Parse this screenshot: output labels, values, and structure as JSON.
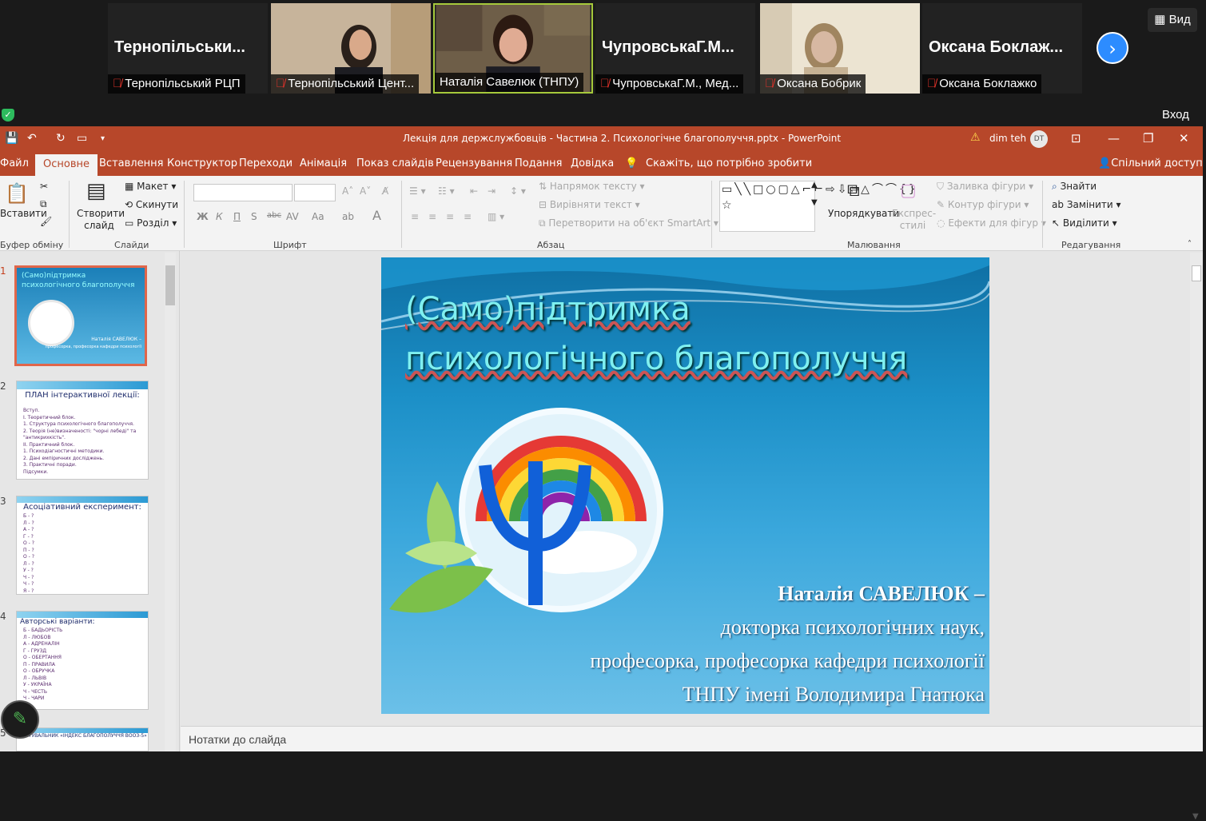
{
  "zoom": {
    "participants": [
      {
        "name": "Тернопільський РЦП",
        "big": "Тернопільськи...",
        "video": false
      },
      {
        "name": "Тернопільський Цент...",
        "big": "",
        "video": true
      },
      {
        "name": "Наталія Савелюк (ТНПУ)",
        "big": "",
        "video": true
      },
      {
        "name": "ЧупровськаГ.М., Мед...",
        "big": "ЧупровськаГ.М...",
        "video": false
      },
      {
        "name": "Оксана Бобрик",
        "big": "",
        "video": true
      },
      {
        "name": "Оксана Боклажко",
        "big": "Оксана  Боклаж...",
        "video": false
      }
    ],
    "view_label": "Вид",
    "login_label": "Вход"
  },
  "powerpoint": {
    "title": "Лекція для держслужбовців - Частина 2. Психологічне благополуччя.pptx  -  PowerPoint",
    "user": "dim teh",
    "user_initials": "DT",
    "tabs": [
      "Файл",
      "Основне",
      "Вставлення",
      "Конструктор",
      "Переходи",
      "Анімація",
      "Показ слайдів",
      "Рецензування",
      "Подання",
      "Довідка"
    ],
    "active_tab": "Основне",
    "tell_me": "Скажіть, що потрібно зробити",
    "share": "Спільний доступ",
    "ribbon": {
      "paste": "Вставити",
      "clipboard": "Буфер обміну",
      "new_slide": "Створити слайд",
      "layout": "Макет",
      "reset": "Скинути",
      "section": "Розділ",
      "slides": "Слайди",
      "font": "Шрифт",
      "paragraph": "Абзац",
      "text_direction": "Напрямок тексту",
      "align_text": "Вирівняти текст",
      "smartart": "Перетворити на об'єкт SmartArt",
      "arrange": "Упорядкувати",
      "quick_styles": "Експрес-стилі",
      "shape_fill": "Заливка фігури",
      "shape_outline": "Контур фігури",
      "shape_effects": "Ефекти для фігур",
      "drawing": "Малювання",
      "find": "Знайти",
      "replace": "Замінити",
      "select": "Виділити",
      "editing": "Редагування"
    },
    "notes_placeholder": "Нотатки до слайда"
  },
  "slide": {
    "title_line1": "(Само)підтримка",
    "title_line2": "психологічного благополуччя",
    "author_line1": "Наталія САВЕЛЮК –",
    "author_line2": "докторка психологічних наук,",
    "author_line3": "професорка, професорка кафедри психології",
    "author_line4": "ТНПУ імені Володимира Гнатюка"
  },
  "thumbnails": [
    {
      "num": "1",
      "title": "(Само)підтримка психологічного благополуччя"
    },
    {
      "num": "2",
      "title": "ПЛАН інтерактивної лекції:",
      "lines": [
        "Вступ.",
        "I. Теоретичний блок.",
        "1. Структура психологічного благополуччя.",
        "2. Теорія (не)визначеності: \"чорні лебеді\" та \"антикрихкість\".",
        "II. Практичний блок.",
        "1. Психодіагностичні методики.",
        "2. Дані емпіричних досліджень.",
        "3. Практичні поради.",
        "Підсумки."
      ]
    },
    {
      "num": "3",
      "title": "Асоціативний експеримент:",
      "lines": [
        "Б - ?",
        "Л - ?",
        "А - ?",
        "Г - ?",
        "О - ?",
        "П - ?",
        "О - ?",
        "Л - ?",
        "У - ?",
        "Ч - ?",
        "Ч - ?",
        "Я - ?"
      ]
    },
    {
      "num": "4",
      "title": "Авторські варіанти:",
      "lines": [
        "Б - БАДЬОРІСТЬ",
        "Л - ЛЮБОВ",
        "А - АДРЕНАЛІН",
        "Г - ГРУЗД",
        "О - ОБЕРТАННЯ",
        "П - ПРАВИЛА",
        "О - ОБРУЧКА",
        "Л - ЛЬВІВ",
        "У - УКРАЇНА",
        "Ч - ЧЕСТЬ",
        "Ч - ЧАРИ"
      ]
    },
    {
      "num": "5",
      "title": "ОПИТУВАЛЬНИК «ІНДЕКС БЛАГОПОЛУЧЧЯ ВООЗ-5»"
    }
  ]
}
